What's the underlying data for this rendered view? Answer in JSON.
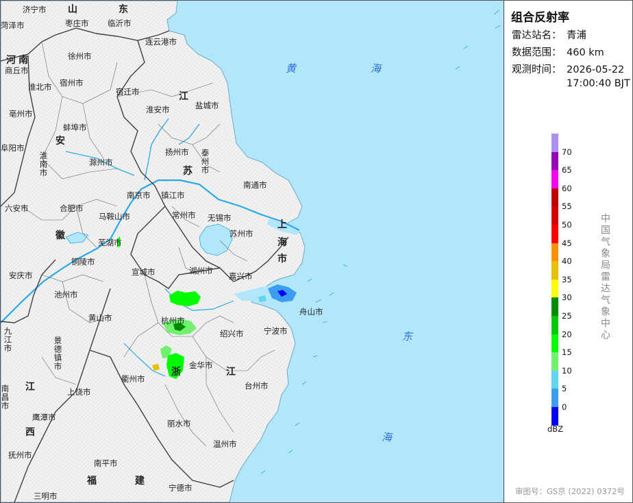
{
  "panel": {
    "title": "组合反射率",
    "station_label": "雷达站名：",
    "station_value": "青浦",
    "range_label": "数据范围：",
    "range_value": "460 km",
    "time_label": "观测时间：",
    "time_date": "2026-05-22",
    "time_clock": "17:00:40 BJT",
    "legend": {
      "unit": "dBZ",
      "ticks": [
        "70",
        "65",
        "60",
        "55",
        "50",
        "45",
        "40",
        "35",
        "30",
        "25",
        "20",
        "15",
        "10",
        "5",
        "0"
      ],
      "colors": [
        "#ad90f0",
        "#9600b4",
        "#ff00f0",
        "#c00000",
        "#d60000",
        "#ff0000",
        "#ff9000",
        "#e7c000",
        "#ffff00",
        "#008c00",
        "#00c800",
        "#02fc02",
        "#72f06f",
        "#63d5f0",
        "#3c9cf2",
        "#0000f6"
      ]
    },
    "agency": "中国气象局雷达气象中心",
    "approval": "审图号：GS京 (2022) 0372号"
  },
  "map": {
    "colors": {
      "sea": "#b2e6fb",
      "land": "#f2f2f2",
      "border": "#4a4a4a",
      "river": "#29a8ea",
      "sea_text": "#2b6fd6"
    },
    "provinces": [
      "山",
      "东",
      "河",
      "南",
      "江",
      "苏",
      "安",
      "徽",
      "上",
      "海",
      "市",
      "浙",
      "江",
      "江",
      "西",
      "福",
      "建"
    ],
    "seas": [
      "黄",
      "海",
      "东",
      "海"
    ],
    "cities": [
      "济宁市",
      "枣庄市",
      "临沂市",
      "菏泽市",
      "连云港市",
      "徐州市",
      "商丘市",
      "淮北市",
      "宿州市",
      "宿迁市",
      "盐城市",
      "亳州市",
      "淮安市",
      "蚌埠市",
      "阜阳市",
      "淮南市",
      "滁州市",
      "扬州市",
      "泰州市",
      "南通市",
      "六安市",
      "合肥市",
      "南京市",
      "镇江市",
      "常州市",
      "无锡市",
      "苏州市",
      "马鞍山市",
      "芜湖市",
      "铜陵市",
      "安庆市",
      "宣城市",
      "湖州市",
      "嘉兴市",
      "池州市",
      "黄山市",
      "杭州市",
      "绍兴市",
      "宁波市",
      "舟山市",
      "九江市",
      "景德镇市",
      "金华市",
      "衢州市",
      "上饶市",
      "台州市",
      "南昌市",
      "鹰潭市",
      "丽水市",
      "抚州市",
      "温州市",
      "南平市",
      "宁德市",
      "三明市"
    ]
  }
}
